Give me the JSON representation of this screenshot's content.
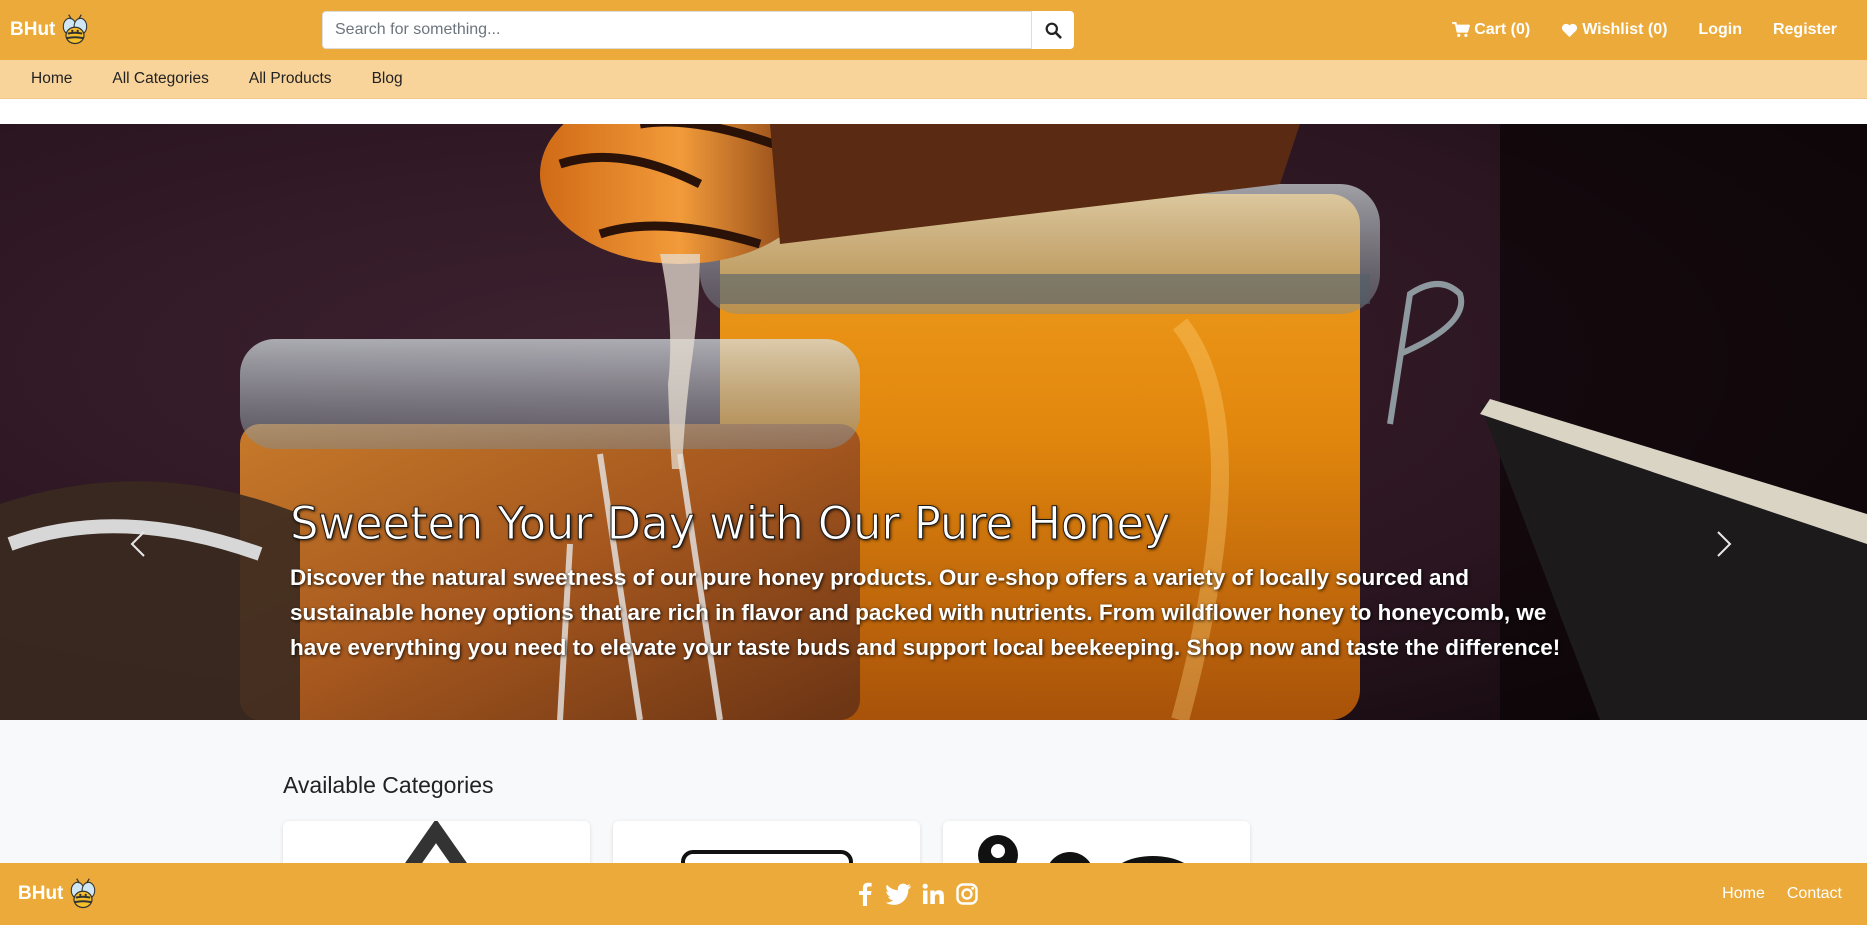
{
  "header": {
    "brand": "BHut",
    "search_placeholder": "Search for something...",
    "cart_label": "Cart (0)",
    "wishlist_label": "Wishlist (0)",
    "login_label": "Login",
    "register_label": "Register"
  },
  "subnav": {
    "items": [
      {
        "label": "Home"
      },
      {
        "label": "All Categories"
      },
      {
        "label": "All Products"
      },
      {
        "label": "Blog"
      }
    ]
  },
  "hero": {
    "title": "Sweeten Your Day with Our Pure Honey",
    "text": "Discover the natural sweetness of our pure honey products. Our e-shop offers a variety of locally sourced and sustainable honey options that are rich in flavor and packed with nutrients. From wildflower honey to honeycomb, we have everything you need to elevate your taste buds and support local beekeeping. Shop now and taste the difference!"
  },
  "categories": {
    "heading": "Available Categories"
  },
  "footer": {
    "brand": "BHut",
    "links": [
      {
        "label": "Home"
      },
      {
        "label": "Contact"
      }
    ],
    "socials": [
      "facebook-icon",
      "twitter-icon",
      "linkedin-icon",
      "instagram-icon"
    ]
  },
  "colors": {
    "brand": "#ebaa3a",
    "subnav": "#f9d49a",
    "section_bg": "#f8f9fa"
  }
}
